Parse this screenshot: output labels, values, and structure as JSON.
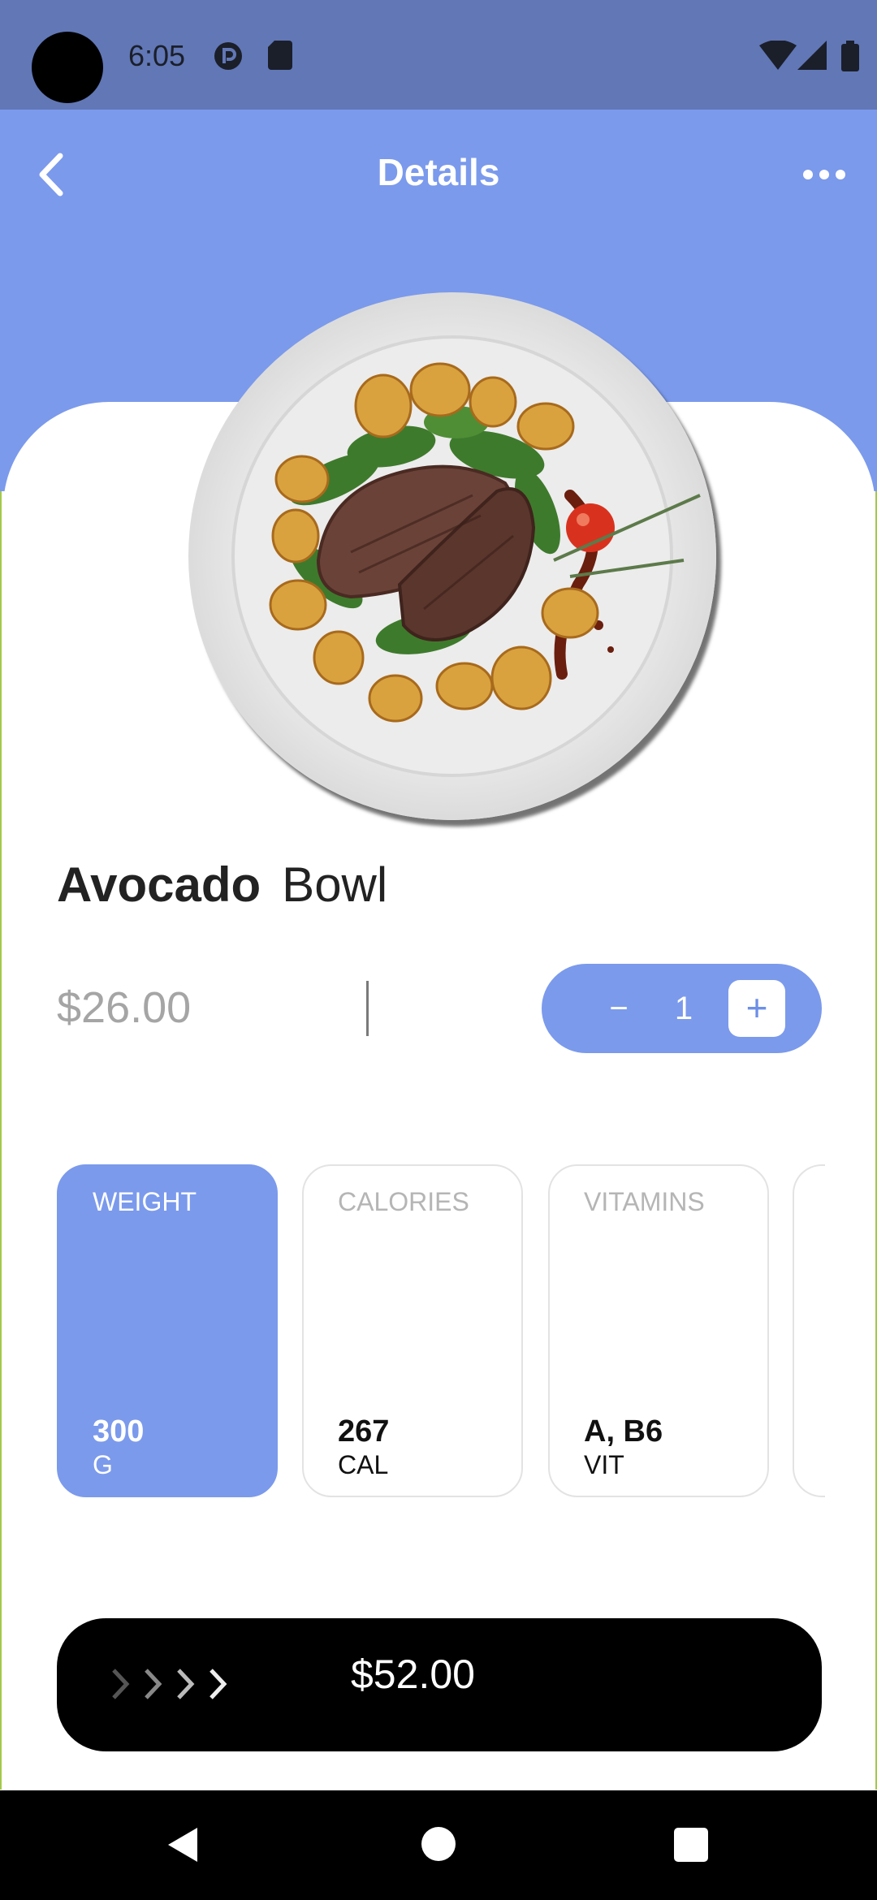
{
  "status_bar": {
    "time": "6:05"
  },
  "header": {
    "title": "Details"
  },
  "dish": {
    "name_bold": "Avocado",
    "name_rest": "Bowl",
    "price": "$26.00"
  },
  "stepper": {
    "minus": "−",
    "quantity": "1",
    "plus": "+"
  },
  "nutrition": [
    {
      "label": "WEIGHT",
      "value": "300",
      "unit": "G",
      "active": true
    },
    {
      "label": "CALORIES",
      "value": "267",
      "unit": "CAL",
      "active": false
    },
    {
      "label": "VITAMINS",
      "value": "A, B6",
      "unit": "VIT",
      "active": false
    }
  ],
  "checkout": {
    "total": "$52.00"
  },
  "colors": {
    "accent": "#7b9aec",
    "status_bar": "#6177b6",
    "button": "#000000"
  },
  "icons": [
    "back-arrow-icon",
    "more-dots-icon",
    "chevrons-icon",
    "nav-back-icon",
    "nav-home-icon",
    "nav-recents-icon"
  ]
}
